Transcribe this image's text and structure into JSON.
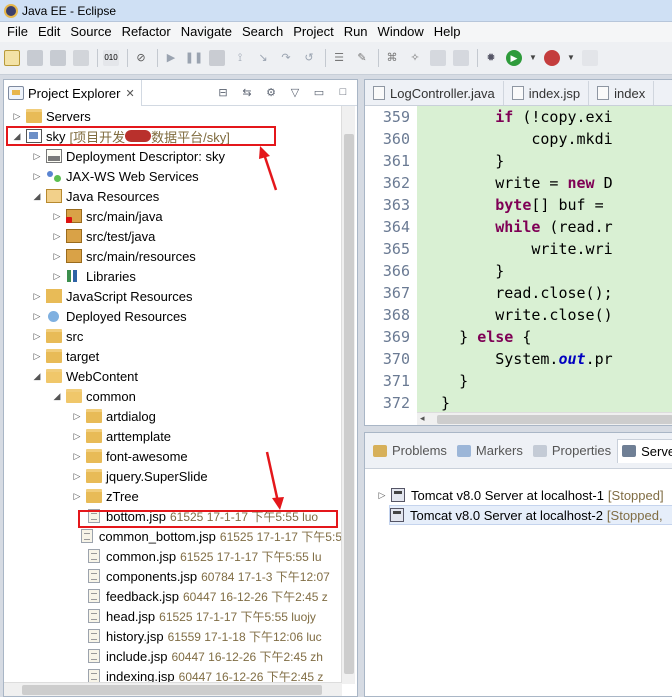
{
  "window": {
    "title": "Java EE - Eclipse"
  },
  "menu": [
    "File",
    "Edit",
    "Source",
    "Refactor",
    "Navigate",
    "Search",
    "Project",
    "Run",
    "Window",
    "Help"
  ],
  "project_explorer": {
    "title": "Project Explorer",
    "close": "✕",
    "tree": [
      {
        "label": "Servers",
        "indent": 0,
        "arrow": "▷",
        "icon": "folder"
      },
      {
        "label": "sky",
        "meta_prefix": "[项目开发",
        "meta_suffix": "数据平台/sky]",
        "indent": 0,
        "arrow": "◢",
        "icon": "project"
      },
      {
        "label": "Deployment Descriptor: sky",
        "indent": 1,
        "arrow": "▷",
        "icon": "dd"
      },
      {
        "label": "JAX-WS Web Services",
        "indent": 1,
        "arrow": "▷",
        "icon": "ws"
      },
      {
        "label": "Java Resources",
        "indent": 1,
        "arrow": "◢",
        "icon": "jres"
      },
      {
        "label": "src/main/java",
        "indent": 2,
        "arrow": "▷",
        "icon": "pkg-err"
      },
      {
        "label": "src/test/java",
        "indent": 2,
        "arrow": "▷",
        "icon": "pkg"
      },
      {
        "label": "src/main/resources",
        "indent": 2,
        "arrow": "▷",
        "icon": "pkg"
      },
      {
        "label": "Libraries",
        "indent": 2,
        "arrow": "▷",
        "icon": "lib"
      },
      {
        "label": "JavaScript Resources",
        "indent": 1,
        "arrow": "▷",
        "icon": "jsres"
      },
      {
        "label": "Deployed Resources",
        "indent": 1,
        "arrow": "▷",
        "icon": "deployed"
      },
      {
        "label": "src",
        "indent": 1,
        "arrow": "▷",
        "icon": "folder"
      },
      {
        "label": "target",
        "indent": 1,
        "arrow": "▷",
        "icon": "folder"
      },
      {
        "label": "WebContent",
        "indent": 1,
        "arrow": "◢",
        "icon": "folder-open"
      },
      {
        "label": "common",
        "indent": 2,
        "arrow": "◢",
        "icon": "folder-open"
      },
      {
        "label": "artdialog",
        "indent": 3,
        "arrow": "▷",
        "icon": "folder"
      },
      {
        "label": "arttemplate",
        "indent": 3,
        "arrow": "▷",
        "icon": "folder"
      },
      {
        "label": "font-awesome",
        "indent": 3,
        "arrow": "▷",
        "icon": "folder"
      },
      {
        "label": "jquery.SuperSlide",
        "indent": 3,
        "arrow": "▷",
        "icon": "folder"
      },
      {
        "label": "zTree",
        "indent": 3,
        "arrow": "▷",
        "icon": "folder"
      },
      {
        "label": "bottom.jsp",
        "meta": "61525  17-1-17 下午5:55  luo",
        "indent": 3,
        "arrow": "",
        "icon": "file"
      },
      {
        "label": "common_bottom.jsp",
        "meta": "61525  17-1-17 下午5:5",
        "indent": 3,
        "arrow": "",
        "icon": "file"
      },
      {
        "label": "common.jsp",
        "meta": "61525  17-1-17 下午5:55  lu",
        "indent": 3,
        "arrow": "",
        "icon": "file"
      },
      {
        "label": "components.jsp",
        "meta": "60784  17-1-3 下午12:07",
        "indent": 3,
        "arrow": "",
        "icon": "file"
      },
      {
        "label": "feedback.jsp",
        "meta": "60447  16-12-26 下午2:45  z",
        "indent": 3,
        "arrow": "",
        "icon": "file"
      },
      {
        "label": "head.jsp",
        "meta": "61525  17-1-17 下午5:55  luojy",
        "indent": 3,
        "arrow": "",
        "icon": "file"
      },
      {
        "label": "history.jsp",
        "meta": "61559  17-1-18 下午12:06  luc",
        "indent": 3,
        "arrow": "",
        "icon": "file"
      },
      {
        "label": "include.jsp",
        "meta": "60447  16-12-26 下午2:45  zh",
        "indent": 3,
        "arrow": "",
        "icon": "file"
      },
      {
        "label": "indexing.jsp",
        "meta": "60447  16-12-26 下午2:45  z",
        "indent": 3,
        "arrow": "",
        "icon": "file"
      }
    ]
  },
  "editor": {
    "tabs": [
      "LogController.java",
      "index.jsp",
      "index"
    ],
    "lines": [
      {
        "n": "359",
        "html": "        <span class=\"kw\">if</span> (!copy.exi"
      },
      {
        "n": "360",
        "html": "            copy.mkdi"
      },
      {
        "n": "361",
        "html": "        }"
      },
      {
        "n": "362",
        "html": "        write = <span class=\"kw\">new</span> D"
      },
      {
        "n": "363",
        "html": "        <span class=\"kw\">byte</span>[] buf ="
      },
      {
        "n": "364",
        "html": "        <span class=\"kw\">while</span> (read.r"
      },
      {
        "n": "365",
        "html": "            write.wri"
      },
      {
        "n": "366",
        "html": "        }"
      },
      {
        "n": "367",
        "html": "        read.close();"
      },
      {
        "n": "368",
        "html": "        write.close()"
      },
      {
        "n": "369",
        "html": "    } <span class=\"kw\">else</span> {"
      },
      {
        "n": "370",
        "html": "        System.<span class=\"field\">out</span>.pr"
      },
      {
        "n": "371",
        "html": "    }"
      },
      {
        "n": "372",
        "html": "  }"
      }
    ]
  },
  "bottom_panel": {
    "tabs": [
      "Problems",
      "Markers",
      "Properties",
      "Serve"
    ],
    "servers": [
      {
        "name": "Tomcat v8.0 Server at localhost-1",
        "status": "[Stopped]"
      },
      {
        "name": "Tomcat v8.0 Server at localhost-2",
        "status": "[Stopped,"
      }
    ]
  },
  "colors": {
    "annotation_red": "#e4171b",
    "code_bg": "#d9f0d3"
  }
}
